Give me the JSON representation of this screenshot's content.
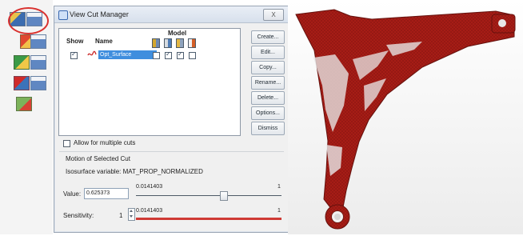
{
  "toolbar": {
    "icons": [
      "view-cut-manager-icon",
      "cut-display-icon",
      "view-orient-icon",
      "model-color-icon",
      "render-icon",
      "query-icon",
      "section-icon",
      "brush-icon",
      "frame-icon"
    ]
  },
  "dialog": {
    "title": "View Cut Manager",
    "close_label": "X",
    "headers": {
      "show": "Show",
      "name": "Name",
      "model": "Model"
    },
    "row": {
      "name": "Opt_Surface",
      "show_checked": true,
      "model_flags": [
        false,
        true,
        true,
        false
      ]
    },
    "buttons": [
      "Create...",
      "Edit...",
      "Copy...",
      "Rename...",
      "Delete...",
      "Options...",
      "Dismiss"
    ],
    "allow_multiple_cuts": "Allow for multiple cuts",
    "motion_section": "Motion of Selected Cut",
    "isosurface_label": "Isosurface variable:",
    "isosurface_value": "MAT_PROP_NORMALIZED",
    "value_label": "Value:",
    "value": "0.625373",
    "value_slider": {
      "min": "0.0141403",
      "max": "1",
      "position_fraction": 0.62
    },
    "sensitivity": {
      "label": "Sensitivity:",
      "number": "1",
      "min": "0.0141403",
      "max": "1"
    }
  },
  "viewport": {
    "part_color": "#a61d16",
    "background": "#e8e8e8"
  }
}
